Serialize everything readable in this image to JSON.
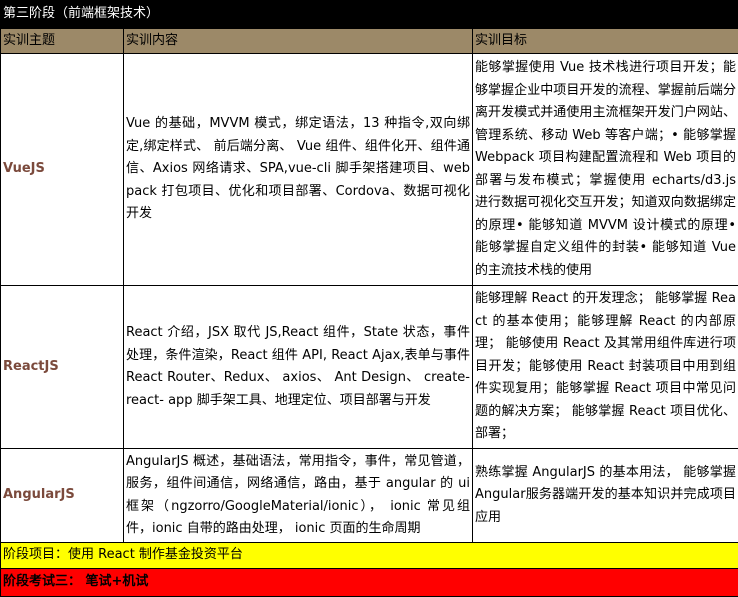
{
  "stage_title": "第三阶段（前端框架技术）",
  "headers": [
    "实训主题",
    "实训内容",
    "实训目标"
  ],
  "rows": [
    {
      "topic": "VueJS",
      "content": "Vue 的基础，MVVM 模式，绑定语法，13 种指令,双向绑定,绑定样式、 前后端分离、 Vue 组件、组件化开、组件通信、Axios 网络请求、SPA,vue-cli 脚手架搭建项目、webpack 打包项目、优化和项目部署、Cordova、数据可视化开发",
      "goal": "能够掌握使用 Vue 技术栈进行项目开发；能够掌握企业中项目开发的流程、掌握前后端分离开发模式并通使用主流框架开发门户网站、管理系统、移动 Web 等客户端；• 能够掌握Webpack 项目构建配置流程和 Web 项目的部署与发布模式；掌握使用 echarts/d3.js 进行数据可视化交互开发；知道双向数据绑定的原理• 能够知道 MVVM 设计模式的原理• 能够掌握自定义组件的封装• 能够知道 Vue 的主流技术栈的使用"
    },
    {
      "topic": "ReactJS",
      "content": "React 介绍，JSX 取代 JS,React 组件，State 状态，事件处理，条件渲染，React 组件 API, React Ajax,表单与事件 React Router、Redux、 axios、 Ant Design、 create- react- app 脚手架工具、地理定位、项目部署与开发",
      "goal": "能够理解 React 的开发理念； 能够掌握 React 的基本使用；能够理解 React 的内部原理； 能够使用 React 及其常用组件库进行项目开发；能够使用 React 封装项目中用到组件实现复用；能够掌握 React 项目中常见问题的解决方案； 能够掌握 React 项目优化、部署；"
    },
    {
      "topic": "AngularJS",
      "content": "AngularJS 概述，基础语法，常用指令，事件，常见管道，服务，组件间通信，网络通信，路由，基于 angular 的 ui 框架（ngzorro/GoogleMaterial/ionic）， ionic 常见组件，ionic 自带的路由处理， ionic 页面的生命周期",
      "goal": "熟练掌握 AngularJS 的基本用法， 能够掌握Angular服务器端开发的基本知识并完成项目应用"
    }
  ],
  "stage_project": "阶段项目：使用 React 制作基金投资平台",
  "stage_exam": "阶段考试三： 笔试+机试",
  "colors": {
    "title_bg": "#000000",
    "header_bg": "#9c8968",
    "topic_text": "#7b4a3c",
    "project_bg": "#ffff00",
    "exam_bg": "#ff0000"
  }
}
